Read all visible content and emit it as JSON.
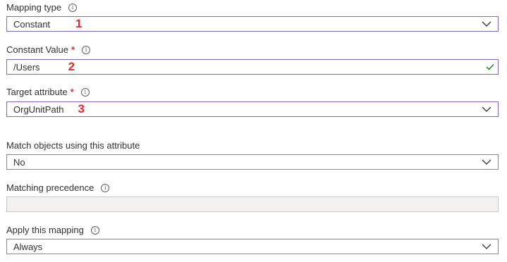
{
  "mapping_type": {
    "label": "Mapping type",
    "value": "Constant",
    "step": "1"
  },
  "constant_value": {
    "label": "Constant Value",
    "required_mark": "*",
    "value": "/Users",
    "step": "2"
  },
  "target_attribute": {
    "label": "Target attribute",
    "required_mark": "*",
    "value": "OrgUnitPath",
    "step": "3"
  },
  "match_objects": {
    "label": "Match objects using this attribute",
    "value": "No"
  },
  "matching_precedence": {
    "label": "Matching precedence",
    "value": ""
  },
  "apply_mapping": {
    "label": "Apply this mapping",
    "value": "Always"
  },
  "info_glyph": "i",
  "colors": {
    "focus_border": "#8764b8",
    "required": "#d13438",
    "step_number": "#e8262f",
    "valid_check": "#107c10"
  }
}
